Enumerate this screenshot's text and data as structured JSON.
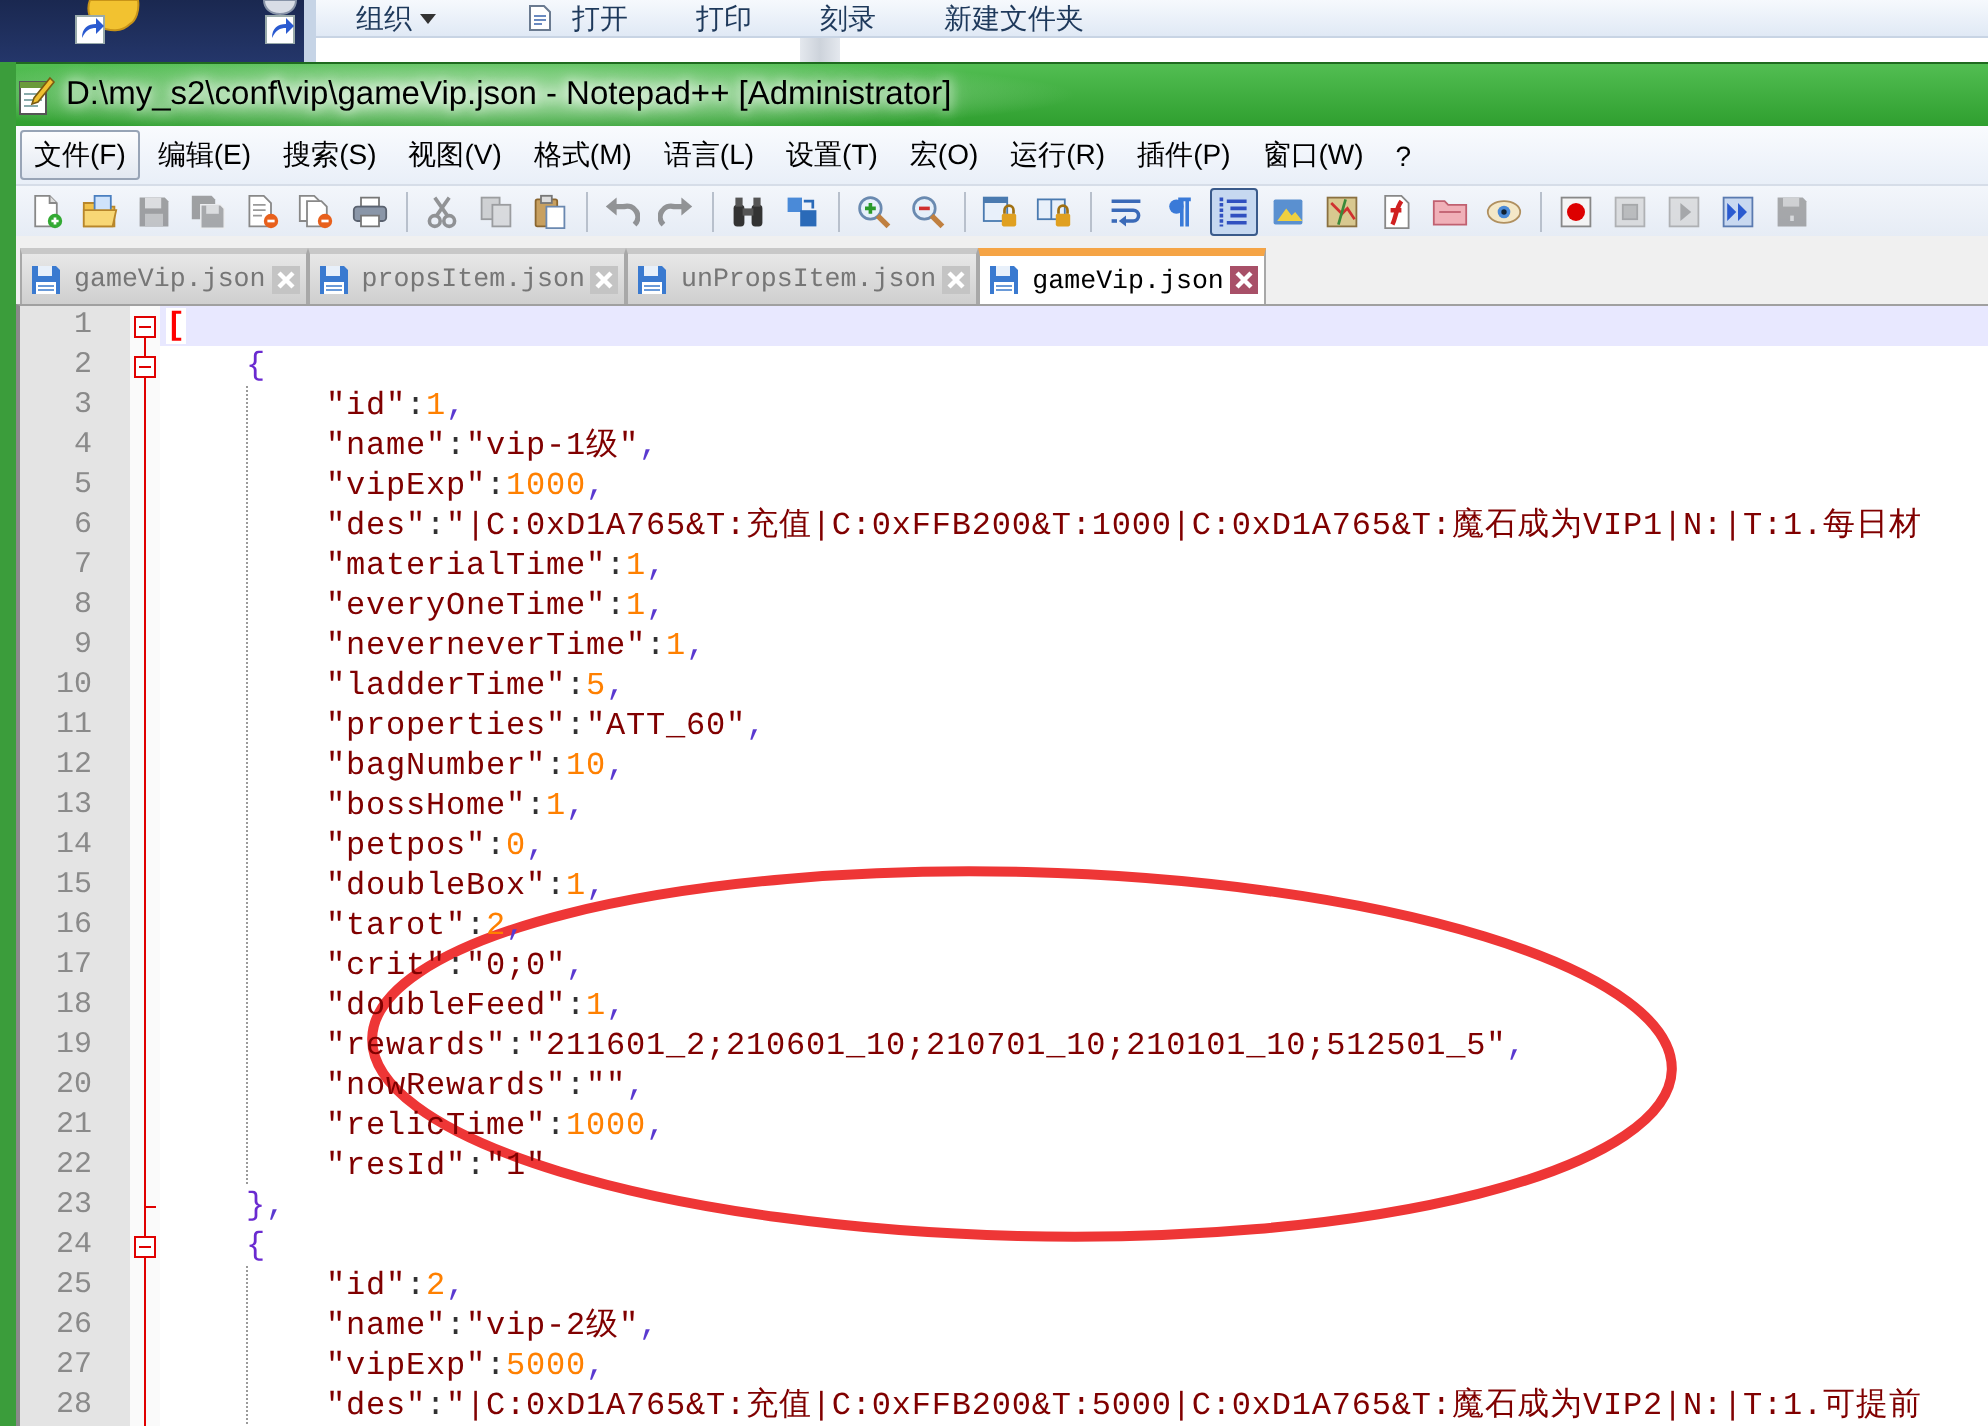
{
  "explorer_window": {
    "toolbar": [
      {
        "kind": "dropdown",
        "label": "组织"
      },
      {
        "kind": "icon",
        "label": "打开"
      },
      {
        "kind": "plain",
        "label": "打印"
      },
      {
        "kind": "plain",
        "label": "刻录"
      },
      {
        "kind": "plain",
        "label": "新建文件夹"
      }
    ]
  },
  "window": {
    "title": "D:\\my_s2\\conf\\vip\\gameVip.json - Notepad++ [Administrator]"
  },
  "menu": [
    {
      "label": "文件(F)",
      "selected": true
    },
    {
      "label": "编辑(E)",
      "selected": false
    },
    {
      "label": "搜索(S)",
      "selected": false
    },
    {
      "label": "视图(V)",
      "selected": false
    },
    {
      "label": "格式(M)",
      "selected": false
    },
    {
      "label": "语言(L)",
      "selected": false
    },
    {
      "label": "设置(T)",
      "selected": false
    },
    {
      "label": "宏(O)",
      "selected": false
    },
    {
      "label": "运行(R)",
      "selected": false
    },
    {
      "label": "插件(P)",
      "selected": false
    },
    {
      "label": "窗口(W)",
      "selected": false
    },
    {
      "label": "?",
      "selected": false
    }
  ],
  "toolbar": [
    [
      {
        "kind": "new",
        "disabled": false,
        "pressed": false
      },
      {
        "kind": "open",
        "disabled": false,
        "pressed": false
      },
      {
        "kind": "save",
        "disabled": true,
        "pressed": false
      },
      {
        "kind": "saveall",
        "disabled": true,
        "pressed": false
      },
      {
        "kind": "close",
        "disabled": false,
        "pressed": false
      },
      {
        "kind": "closeall",
        "disabled": false,
        "pressed": false
      },
      {
        "kind": "print",
        "disabled": false,
        "pressed": false
      }
    ],
    [
      {
        "kind": "cut",
        "disabled": true,
        "pressed": false
      },
      {
        "kind": "copy",
        "disabled": true,
        "pressed": false
      },
      {
        "kind": "paste",
        "disabled": false,
        "pressed": false
      }
    ],
    [
      {
        "kind": "undo",
        "disabled": true,
        "pressed": false
      },
      {
        "kind": "redo",
        "disabled": true,
        "pressed": false
      }
    ],
    [
      {
        "kind": "find",
        "disabled": false,
        "pressed": false
      },
      {
        "kind": "replace",
        "disabled": false,
        "pressed": false
      }
    ],
    [
      {
        "kind": "zoomin",
        "disabled": false,
        "pressed": false
      },
      {
        "kind": "zoomout",
        "disabled": false,
        "pressed": false
      }
    ],
    [
      {
        "kind": "syncv",
        "disabled": false,
        "pressed": false
      },
      {
        "kind": "synch",
        "disabled": false,
        "pressed": false
      }
    ],
    [
      {
        "kind": "wrap",
        "disabled": false,
        "pressed": false
      },
      {
        "kind": "allchars",
        "disabled": false,
        "pressed": false
      },
      {
        "kind": "indentguide",
        "disabled": false,
        "pressed": true
      },
      {
        "kind": "udl",
        "disabled": false,
        "pressed": false
      },
      {
        "kind": "docmap",
        "disabled": false,
        "pressed": false
      },
      {
        "kind": "funclist",
        "disabled": false,
        "pressed": false
      },
      {
        "kind": "folder",
        "disabled": false,
        "pressed": false
      },
      {
        "kind": "monitor",
        "disabled": false,
        "pressed": false
      }
    ],
    [
      {
        "kind": "record",
        "disabled": false,
        "pressed": false
      },
      {
        "kind": "stop",
        "disabled": true,
        "pressed": false
      },
      {
        "kind": "play",
        "disabled": true,
        "pressed": false
      },
      {
        "kind": "playmulti",
        "disabled": false,
        "pressed": false
      },
      {
        "kind": "savemacro",
        "disabled": true,
        "pressed": false
      }
    ]
  ],
  "tabs": [
    {
      "label": "gameVip.json",
      "selected": false
    },
    {
      "label": "propsItem.json",
      "selected": false
    },
    {
      "label": "unPropsItem.json",
      "selected": false
    },
    {
      "label": "gameVip.json",
      "selected": true
    }
  ],
  "editor": {
    "lines": [
      {
        "number": "1",
        "text": "[",
        "current": true,
        "expanded": true,
        "children": [
          {
            "number": "2",
            "text": "{",
            "current": false,
            "expanded": true,
            "children": [
              {
                "number": "3",
                "text": "\"id\":1,",
                "current": false
              },
              {
                "number": "4",
                "text": "\"name\":\"vip-1级\",",
                "current": false
              },
              {
                "number": "5",
                "text": "\"vipExp\":1000,",
                "current": false
              },
              {
                "number": "6",
                "text": "\"des\":\"|C:0xD1A765&T:充值|C:0xFFB200&T:1000|C:0xD1A765&T:魔石成为VIP1|N:|T:1.每日材",
                "current": false
              },
              {
                "number": "7",
                "text": "\"materialTime\":1,",
                "current": false
              },
              {
                "number": "8",
                "text": "\"everyOneTime\":1,",
                "current": false
              },
              {
                "number": "9",
                "text": "\"neverneverTime\":1,",
                "current": false
              },
              {
                "number": "10",
                "text": "\"ladderTime\":5,",
                "current": false
              },
              {
                "number": "11",
                "text": "\"properties\":\"ATT_60\",",
                "current": false
              },
              {
                "number": "12",
                "text": "\"bagNumber\":10,",
                "current": false
              },
              {
                "number": "13",
                "text": "\"bossHome\":1,",
                "current": false
              },
              {
                "number": "14",
                "text": "\"petpos\":0,",
                "current": false
              },
              {
                "number": "15",
                "text": "\"doubleBox\":1,",
                "current": false
              },
              {
                "number": "16",
                "text": "\"tarot\":2,",
                "current": false
              },
              {
                "number": "17",
                "text": "\"crit\":\"0;0\",",
                "current": false
              },
              {
                "number": "18",
                "text": "\"doubleFeed\":1,",
                "current": false
              },
              {
                "number": "19",
                "text": "\"rewards\":\"211601_2;210601_10;210701_10;210101_10;512501_5\",",
                "current": false
              },
              {
                "number": "20",
                "text": "\"nowRewards\":\"\",",
                "current": false
              },
              {
                "number": "21",
                "text": "\"relicTime\":1000,",
                "current": false
              },
              {
                "number": "22",
                "text": "\"resId\":\"1\"",
                "current": false
              }
            ],
            "close": {
              "number": "23",
              "text": "},",
              "current": false
            }
          },
          {
            "number": "24",
            "text": "{",
            "current": false,
            "expanded": true,
            "children": [
              {
                "number": "25",
                "text": "\"id\":2,",
                "current": false
              },
              {
                "number": "26",
                "text": "\"name\":\"vip-2级\",",
                "current": false
              },
              {
                "number": "27",
                "text": "\"vipExp\":5000,",
                "current": false
              },
              {
                "number": "28",
                "text": "\"des\":\"|C:0xD1A765&T:充值|C:0xFFB200&T:5000|C:0xD1A765&T:魔石成为VIP2|N:|T:1.可提前",
                "current": false
              }
            ]
          }
        ]
      }
    ]
  }
}
